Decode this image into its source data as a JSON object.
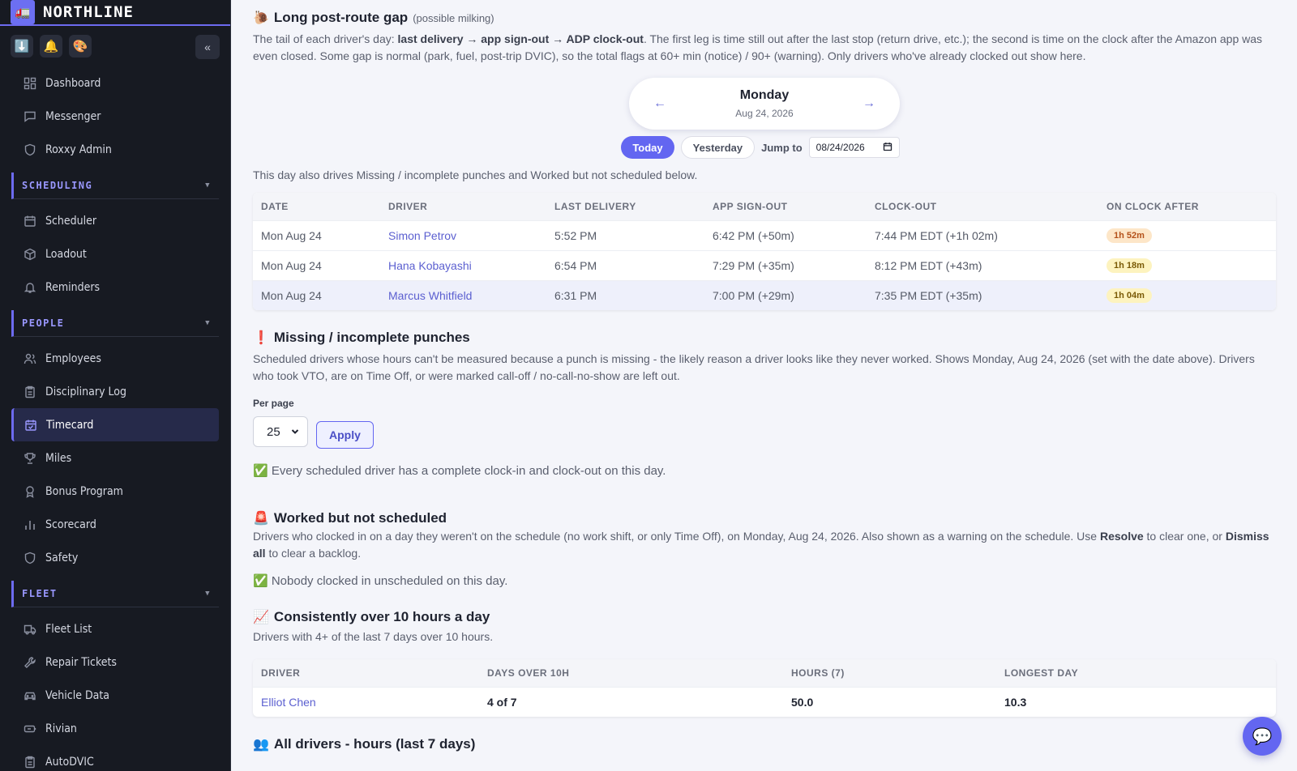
{
  "brand": {
    "name": "NORTHLINE",
    "logo_icon": "🚛"
  },
  "toolbar": {
    "icons": [
      "⬇️",
      "🔔",
      "🎨"
    ],
    "collapse": "«"
  },
  "sidebar": {
    "top_items": [
      {
        "label": "Dashboard",
        "icon": "dashboard-icon"
      },
      {
        "label": "Messenger",
        "icon": "chat-icon"
      },
      {
        "label": "Roxxy Admin",
        "icon": "shield-icon"
      }
    ],
    "sections": [
      {
        "title": "SCHEDULING",
        "items": [
          {
            "label": "Scheduler",
            "icon": "calendar-icon"
          },
          {
            "label": "Loadout",
            "icon": "box-icon"
          },
          {
            "label": "Reminders",
            "icon": "bell-icon"
          }
        ]
      },
      {
        "title": "PEOPLE",
        "items": [
          {
            "label": "Employees",
            "icon": "users-icon"
          },
          {
            "label": "Disciplinary Log",
            "icon": "clipboard-icon"
          },
          {
            "label": "Timecard",
            "icon": "calendar-check-icon",
            "active": true
          },
          {
            "label": "Miles",
            "icon": "trophy-icon"
          },
          {
            "label": "Bonus Program",
            "icon": "award-icon"
          },
          {
            "label": "Scorecard",
            "icon": "bar-chart-icon"
          },
          {
            "label": "Safety",
            "icon": "shield-icon"
          }
        ]
      },
      {
        "title": "FLEET",
        "items": [
          {
            "label": "Fleet List",
            "icon": "truck-icon"
          },
          {
            "label": "Repair Tickets",
            "icon": "wrench-icon"
          },
          {
            "label": "Vehicle Data",
            "icon": "car-icon"
          },
          {
            "label": "Rivian",
            "icon": "battery-icon"
          },
          {
            "label": "AutoDVIC",
            "icon": "clipboard-icon"
          }
        ]
      }
    ]
  },
  "gap": {
    "emoji": "🐌",
    "title": "Long post-route gap",
    "subtitle": "(possible milking)",
    "desc_1": "The tail of each driver's day: ",
    "desc_bold": "last delivery → app sign-out → ADP clock-out",
    "desc_2": ". The first leg is time still out after the last stop (return drive, etc.); the second is time on the clock after the Amazon app was even closed. Some gap is normal (park, fuel, post-trip DVIC), so the total flags at 60+ min (notice) / 90+ (warning). Only drivers who've already clocked out show here.",
    "day_name": "Monday",
    "day_date": "Aug 24, 2026",
    "prev": "←",
    "next": "→",
    "today": "Today",
    "yesterday": "Yesterday",
    "jump_to": "Jump to",
    "date_value": "08/24/2026",
    "note": "This day also drives Missing / incomplete punches and Worked but not scheduled below.",
    "columns": [
      "DATE",
      "DRIVER",
      "LAST DELIVERY",
      "APP SIGN-OUT",
      "CLOCK-OUT",
      "ON CLOCK AFTER"
    ],
    "rows": [
      {
        "date": "Mon Aug 24",
        "driver": "Simon Petrov",
        "last": "5:52 PM",
        "signout": "6:42 PM (+50m)",
        "clockout": "7:44 PM EDT (+1h 02m)",
        "after": "1h 52m",
        "level": "orange"
      },
      {
        "date": "Mon Aug 24",
        "driver": "Hana Kobayashi",
        "last": "6:54 PM",
        "signout": "7:29 PM (+35m)",
        "clockout": "8:12 PM EDT (+43m)",
        "after": "1h 18m",
        "level": "yellow"
      },
      {
        "date": "Mon Aug 24",
        "driver": "Marcus Whitfield",
        "last": "6:31 PM",
        "signout": "7:00 PM (+29m)",
        "clockout": "7:35 PM EDT (+35m)",
        "after": "1h 04m",
        "level": "yellow"
      }
    ]
  },
  "missing": {
    "emoji": "❗",
    "title": "Missing / incomplete punches",
    "desc": "Scheduled drivers whose hours can't be measured because a punch is missing - the likely reason a driver looks like they never worked. Shows Monday, Aug 24, 2026 (set with the date above). Drivers who took VTO, are on Time Off, or were marked call-off / no-call-no-show are left out.",
    "per_page_label": "Per page",
    "per_page_value": "25",
    "apply": "Apply",
    "ok": "✅ Every scheduled driver has a complete clock-in and clock-out on this day."
  },
  "unscheduled": {
    "emoji": "🚨",
    "title": "Worked but not scheduled",
    "desc_1": "Drivers who clocked in on a day they weren't on the schedule (no work shift, or only Time Off), on Monday, Aug 24, 2026. Also shown as a warning on the schedule. Use ",
    "resolve": "Resolve",
    "desc_2": " to clear one, or ",
    "dismiss": "Dismiss all",
    "desc_3": " to clear a backlog.",
    "ok": "✅ Nobody clocked in unscheduled on this day."
  },
  "over10": {
    "emoji": "📈",
    "title": "Consistently over 10 hours a day",
    "desc": "Drivers with 4+ of the last 7 days over 10 hours.",
    "columns": [
      "DRIVER",
      "DAYS OVER 10H",
      "HOURS (7)",
      "LONGEST DAY"
    ],
    "rows": [
      {
        "driver": "Elliot Chen",
        "days": "4 of 7",
        "hours": "50.0",
        "longest": "10.3"
      }
    ]
  },
  "all_drivers": {
    "emoji": "👥",
    "title": "All drivers - hours (last 7 days)"
  },
  "chat": {
    "icon": "💬"
  }
}
